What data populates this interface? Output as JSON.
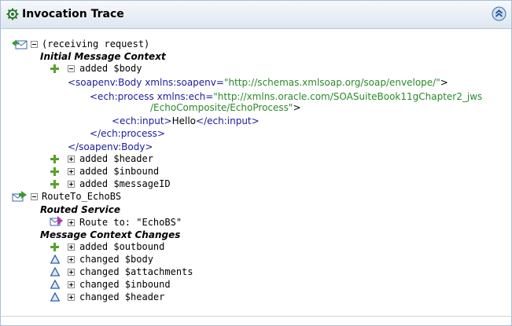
{
  "panel": {
    "title": "Invocation Trace"
  },
  "tree": {
    "request": {
      "label": "(receiving request)",
      "context_heading": "Initial Message Context",
      "body_label": "added $body",
      "xml": {
        "body_open_tag": "<soapenv:Body",
        "body_open_attr": " xmlns:soapenv=",
        "body_open_val": "\"http://schemas.xmlsoap.org/soap/envelope/\"",
        "body_open_end": ">",
        "process_open_tag": "<ech:process",
        "process_open_attr": " xmlns:ech=",
        "process_open_val1": "\"http://xmlns.oracle.com/SOASuiteBook11gChapter2_jws",
        "process_open_val2": "/EchoComposite/EchoProcess\"",
        "process_open_end": ">",
        "input_open": "<ech:input>",
        "input_text": "Hello",
        "input_close": "</ech:input>",
        "process_close": "</ech:process>",
        "body_close": "</soapenv:Body>"
      },
      "items": [
        "added $header",
        "added $inbound",
        "added $messageID"
      ]
    },
    "route": {
      "label": "RouteTo_EchoBS",
      "routed_heading": "Routed Service",
      "route_label": "Route to: \"EchoBS\"",
      "changes_heading": "Message Context Changes",
      "changes": [
        {
          "label": "added $outbound",
          "icon": "plus-icon"
        },
        {
          "label": "changed $body",
          "icon": "delta-icon"
        },
        {
          "label": "changed $attachments",
          "icon": "delta-icon"
        },
        {
          "label": "changed $inbound",
          "icon": "delta-icon"
        },
        {
          "label": "changed $header",
          "icon": "delta-icon"
        }
      ]
    }
  },
  "colors": {
    "xml_tag": "#1b1ba0",
    "xml_value": "#2a8a2a",
    "plus_green": "#5aa02c",
    "delta_blue": "#2a5ea8"
  }
}
